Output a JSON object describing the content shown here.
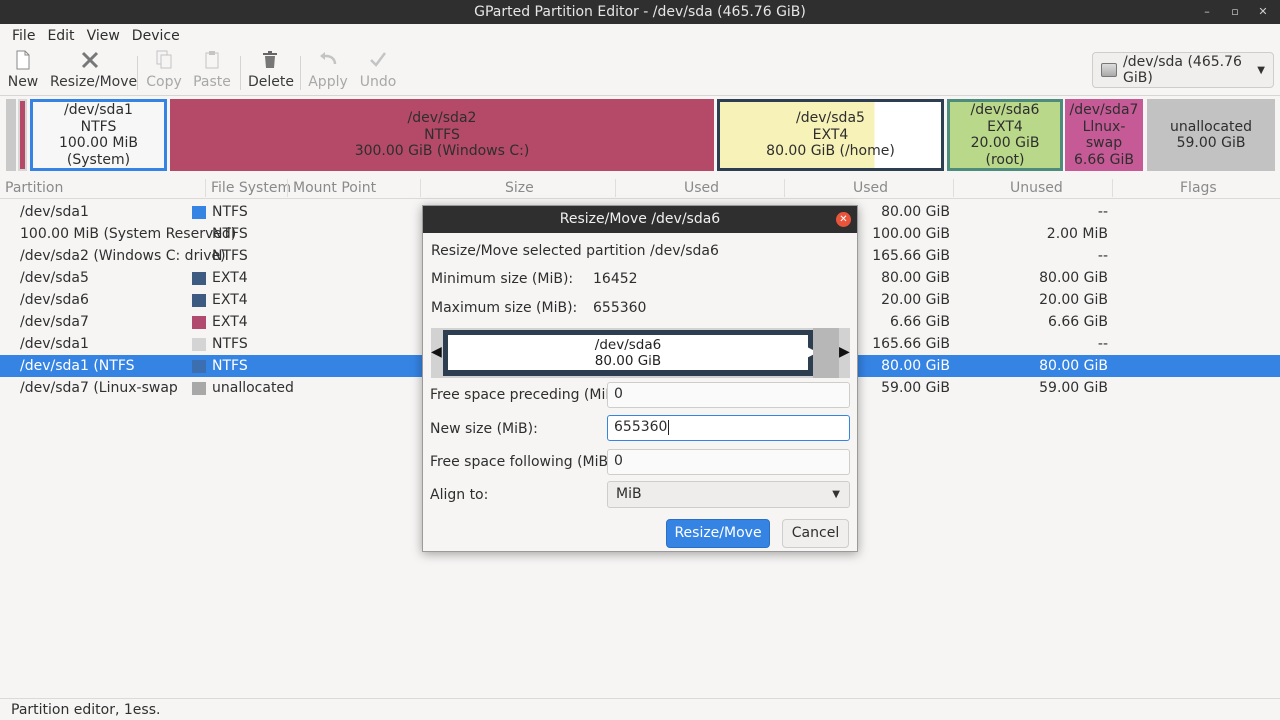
{
  "window": {
    "title": "GParted Partition Editor - /dev/sda (465.76 GiB)",
    "controls": [
      "–",
      "▫",
      "✕"
    ]
  },
  "menu": [
    "File",
    "Edit",
    "View",
    "Device"
  ],
  "toolbar": {
    "new": "New",
    "resize_move": "Resize/Move",
    "copy": "Copy",
    "paste": "Paste",
    "delete": "Delete",
    "apply": "Apply",
    "undo": "Undo"
  },
  "device_selector": "/dev/sda  (465.76 GiB)",
  "partition_map": [
    {
      "name": "/dev/sda1",
      "fs": "NTFS",
      "info": "100.00 MiB (System)"
    },
    {
      "name": "/dev/sda2",
      "fs": "NTFS",
      "info": "300.00 GiB (Windows C:)"
    },
    {
      "name": "/dev/sda5",
      "fs": "EXT4",
      "info": "80.00 GiB (/home)"
    },
    {
      "name": "/dev/sda6",
      "fs": "EXT4",
      "info": "20.00 GiB (root)"
    },
    {
      "name": "/dev/sda7",
      "fs": "Llnux-swap",
      "info": "6.66 GiB"
    },
    {
      "name": "unallocated",
      "fs": "59.00 GiB",
      "info": ""
    }
  ],
  "columns": {
    "partition": "Partition",
    "file_system": "File System",
    "mount_point": "Mount Point",
    "size": "Size",
    "used": "Used",
    "used2": "Used",
    "unused": "Unused",
    "flags": "Flags"
  },
  "rows": [
    {
      "partition": "/dev/sda1",
      "fs": "NTFS",
      "color": "#3584e4",
      "used": "80.00 GiB",
      "unused": "--"
    },
    {
      "partition": "100.00 MiB (System Reserved)",
      "fs": "NTFS",
      "color": "",
      "used": "100.00 GiB",
      "unused": "2.00 MiB"
    },
    {
      "partition": "/dev/sda2 (Windows C: drive)",
      "fs": "NTFS",
      "color": "",
      "used": "165.66 GiB",
      "unused": "--"
    },
    {
      "partition": "/dev/sda5",
      "fs": "EXT4",
      "color": "#3d5a80",
      "used": "80.00 GiB",
      "unused": "80.00 GiB"
    },
    {
      "partition": "/dev/sda6",
      "fs": "EXT4",
      "color": "#3d5a80",
      "used": "20.00 GiB",
      "unused": "20.00 GiB"
    },
    {
      "partition": "/dev/sda7",
      "fs": "EXT4",
      "color": "#b04a6e",
      "used": "6.66 GiB",
      "unused": "6.66 GiB"
    },
    {
      "partition": "/dev/sda1",
      "fs": "NTFS",
      "color": "#d4d4d4",
      "used": "165.66 GiB",
      "unused": "--"
    },
    {
      "partition": "/dev/sda1 (NTFS",
      "fs": "NTFS",
      "color": "#3c6fb0",
      "used": "80.00 GiB",
      "unused": "80.00 GiB"
    },
    {
      "partition": "/dev/sda7 (Linux-swap",
      "fs": "unallocated",
      "color": "#a8a8a8",
      "used": "59.00 GiB",
      "unused": "59.00 GiB"
    }
  ],
  "dialog": {
    "title": "Resize/Move /dev/sda6",
    "subtitle": "Resize/Move selected partition /dev/sda6",
    "min_label": "Minimum size (MiB):",
    "min_value": "16452",
    "max_label": "Maximum size (MiB):",
    "max_value": "655360",
    "graphic_name": "/dev/sda6",
    "graphic_size": "80.00 GiB",
    "preceding_label": "Free space preceding (MiB):",
    "preceding_value": "0",
    "new_size_label": "New size (MiB):",
    "new_size_value": "655360",
    "following_label": "Free space following (MiB):",
    "following_value": "0",
    "align_label": "Align to:",
    "align_value": "MiB",
    "ok_button": "Resize/Move",
    "cancel_button": "Cancel"
  },
  "status": "Partition editor, 1ess."
}
